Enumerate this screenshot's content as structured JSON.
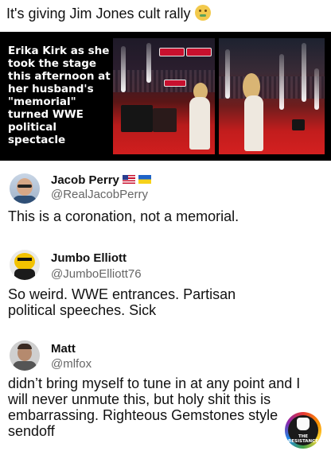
{
  "post": {
    "caption": "It's giving Jim Jones cult rally",
    "caption_emoji": "nauseated-face-icon"
  },
  "news_card": {
    "headline": "Erika Kirk as she took the stage this afternoon at her husband's \"memorial\" turned WWE political spectacle",
    "accent_color": "#c8102e"
  },
  "tweets": [
    {
      "name": "Jacob Perry",
      "handle": "@RealJacobPerry",
      "flags": [
        "us-flag-icon",
        "ukraine-flag-icon"
      ],
      "text": "This is a coronation, not a memorial."
    },
    {
      "name": "Jumbo Elliott",
      "handle": "@JumboElliott76",
      "text": "So weird. WWE entrances. Partisan political speeches. Sick"
    },
    {
      "name": "Matt",
      "handle": "@mlfox",
      "text": "didn’t bring myself to tune in at any point and I will never unmute this, but holy shit this is embarrassing. Righteous Gemstones style sendoff"
    }
  ],
  "watermark": {
    "text": "THE RESISTANCE"
  }
}
